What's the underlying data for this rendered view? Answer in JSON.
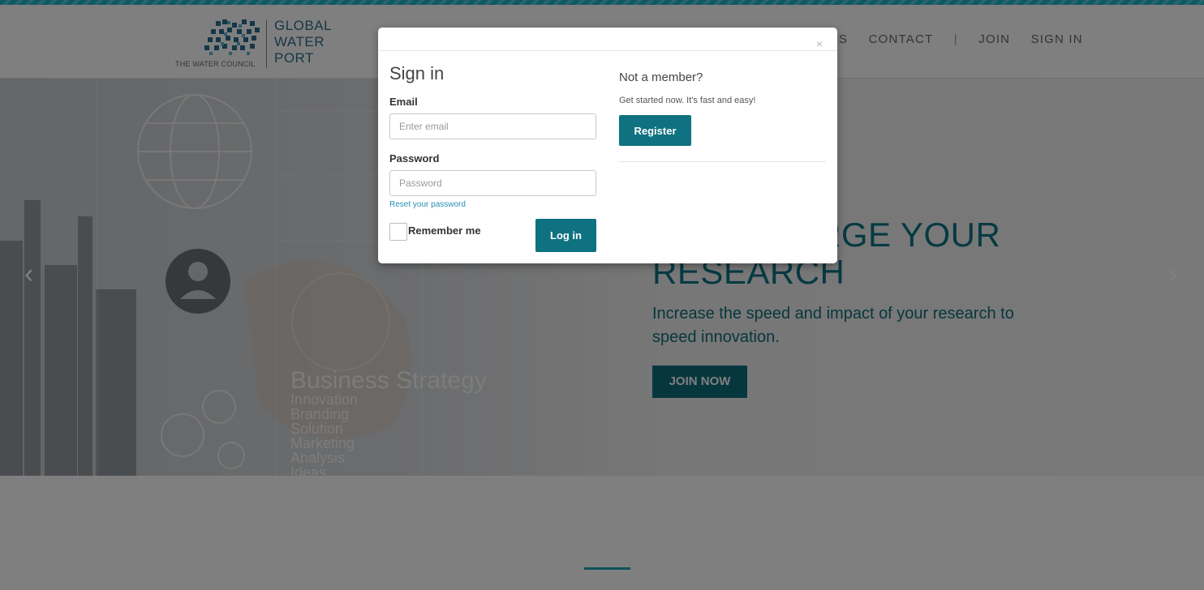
{
  "header": {
    "logo": {
      "org": "THE WATER COUNCIL",
      "words": [
        "GLOBAL",
        "WATER",
        "PORT"
      ]
    },
    "nav": {
      "partial": "S",
      "contact": "CONTACT",
      "separator": "|",
      "join": "JOIN",
      "signin": "SIGN IN"
    }
  },
  "hero": {
    "title_visible": "RGE YOUR",
    "title_line2": "RESEARCH",
    "subtitle": "Increase the speed and impact of your research to speed innovation.",
    "cta": "JOIN NOW",
    "image_words": [
      "Business Strategy",
      "Innovation",
      "Branding",
      "Solution",
      "Marketing",
      "Analysis",
      "Ideas"
    ]
  },
  "modal": {
    "close": "×",
    "signin_title": "Sign in",
    "email_label": "Email",
    "email_placeholder": "Enter email",
    "password_label": "Password",
    "password_placeholder": "Password",
    "reset_link": "Reset your password",
    "remember_label": "Remember me",
    "login_button": "Log in",
    "not_member_title": "Not a member?",
    "get_started": "Get started now. It's fast and easy!",
    "register_button": "Register"
  },
  "colors": {
    "accent": "#0f7280",
    "stripe": "#1fb5c4",
    "hero_text": "#0e7585"
  },
  "icons": {
    "carousel_prev": "chevron-left-icon",
    "carousel_next": "chevron-right-icon",
    "close": "close-icon"
  }
}
